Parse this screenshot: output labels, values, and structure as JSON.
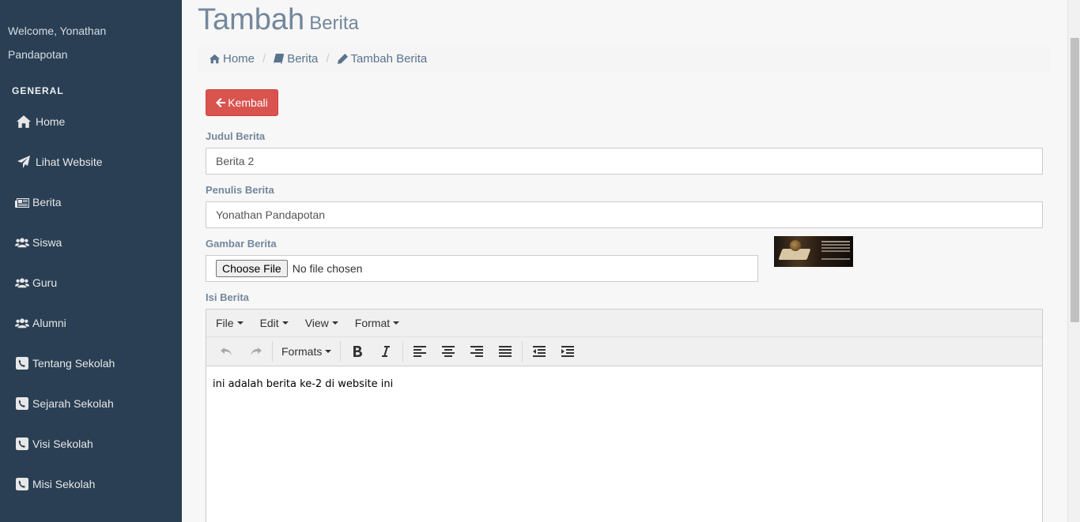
{
  "sidebar": {
    "welcome": "Welcome, Yonathan Pandapotan",
    "section_title": "GENERAL",
    "items": [
      {
        "label": "Home",
        "icon": "home-icon"
      },
      {
        "label": "Lihat Website",
        "icon": "paper-plane-icon"
      },
      {
        "label": "Berita",
        "icon": "newspaper-icon"
      },
      {
        "label": "Siswa",
        "icon": "users-icon"
      },
      {
        "label": "Guru",
        "icon": "users-icon"
      },
      {
        "label": "Alumni",
        "icon": "users-icon"
      },
      {
        "label": "Tentang Sekolah",
        "icon": "phone-square-icon"
      },
      {
        "label": "Sejarah Sekolah",
        "icon": "phone-square-icon"
      },
      {
        "label": "Visi Sekolah",
        "icon": "phone-square-icon"
      },
      {
        "label": "Misi Sekolah",
        "icon": "phone-square-icon"
      }
    ]
  },
  "header": {
    "title": "Tambah",
    "subtitle": "Berita"
  },
  "breadcrumb": {
    "home": "Home",
    "berita": "Berita",
    "current": "Tambah Berita"
  },
  "back_button": "Kembali",
  "form": {
    "judul_label": "Judul Berita",
    "judul_value": "Berita 2",
    "penulis_label": "Penulis Berita",
    "penulis_value": "Yonathan Pandapotan",
    "gambar_label": "Gambar Berita",
    "file_button": "Choose File",
    "file_status": "No file chosen",
    "isi_label": "Isi Berita"
  },
  "editor": {
    "menu": [
      "File",
      "Edit",
      "View",
      "Format"
    ],
    "formats_label": "Formats",
    "content": "ini adalah berita ke-2 di website ini"
  },
  "colors": {
    "sidebar_bg": "#2a3f54",
    "danger": "#d9534f",
    "label": "#73879c"
  }
}
